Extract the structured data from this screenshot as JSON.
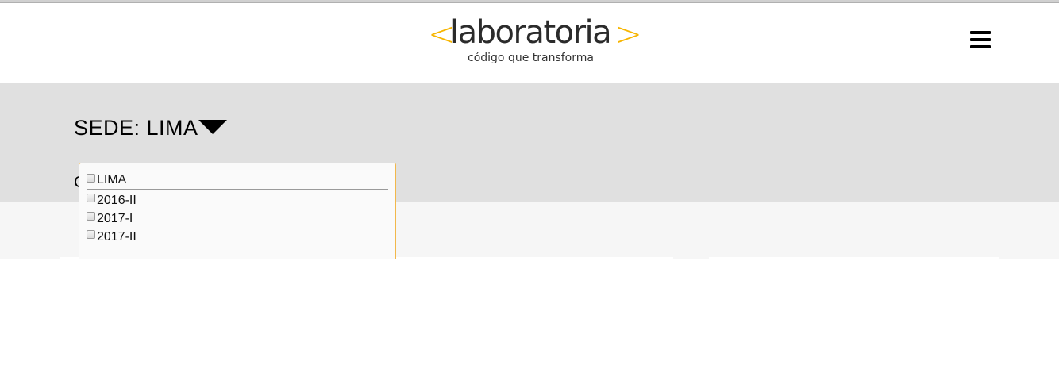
{
  "header": {
    "logo": {
      "bracket_left": "<",
      "wordmark": "laboratoria",
      "bracket_right": ">",
      "tagline": "código que transforma",
      "accent_color": "#f7b500"
    },
    "menu_icon": "hamburger-menu-icon"
  },
  "sede": {
    "label": "SEDE: LIMA",
    "caret_icon": "caret-down-icon",
    "partial_label": "C"
  },
  "dropdown": {
    "items": [
      {
        "label": "LIMA",
        "checked": false
      },
      {
        "label": "2016-II",
        "checked": false
      },
      {
        "label": "2017-I",
        "checked": false
      },
      {
        "label": "2017-II",
        "checked": false
      }
    ]
  }
}
